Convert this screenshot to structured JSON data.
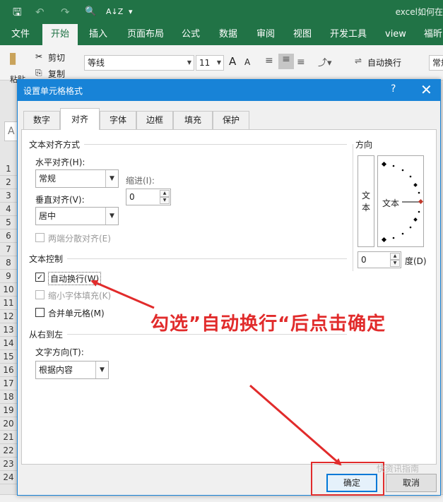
{
  "window": {
    "title": "excel如何在"
  },
  "quick_access": {
    "save": "🖫",
    "undo": "↶",
    "redo": "↷",
    "preview": "🔍",
    "sort": "A↓Z",
    "more": "▾"
  },
  "ribbon_tabs": [
    "文件",
    "开始",
    "插入",
    "页面布局",
    "公式",
    "数据",
    "审阅",
    "视图",
    "开发工具",
    "view",
    "福昕阅"
  ],
  "ribbon": {
    "paste_label": "粘贴",
    "cut_label": "剪切",
    "copy_label": "复制",
    "font_name": "等线",
    "font_size": "11",
    "grow_font": "A",
    "shrink_font": "A",
    "wrap_text": "自动换行",
    "format_value": "常规"
  },
  "sheet": {
    "namebox": "A",
    "rows": [
      "1",
      "2",
      "3",
      "4",
      "5",
      "6",
      "7",
      "8",
      "9",
      "10",
      "11",
      "12",
      "13",
      "14",
      "15",
      "16",
      "17",
      "18",
      "19",
      "20",
      "21",
      "22",
      "23",
      "24"
    ]
  },
  "dialog": {
    "title": "设置单元格格式",
    "help": "?",
    "close": "✕",
    "tabs": [
      "数字",
      "对齐",
      "字体",
      "边框",
      "填充",
      "保护"
    ],
    "text_alignment": {
      "group": "文本对齐方式",
      "horizontal_label": "水平对齐(H):",
      "horizontal_value": "常规",
      "indent_label": "缩进(I):",
      "indent_value": "0",
      "vertical_label": "垂直对齐(V):",
      "vertical_value": "居中",
      "justify_distributed": "两端分散对齐(E)"
    },
    "text_control": {
      "group": "文本控制",
      "wrap_text": "自动换行(W)",
      "wrap_checked": true,
      "shrink_to_fit": "缩小字体填充(K)",
      "merge_cells": "合并单元格(M)"
    },
    "rtl": {
      "group": "从右到左",
      "direction_label": "文字方向(T):",
      "direction_value": "根据内容"
    },
    "orientation": {
      "group": "方向",
      "vertical_text": "文\n本",
      "dial_text": "文本",
      "degrees_value": "0",
      "degrees_label": "度(D)"
    },
    "ok": "确定",
    "cancel": "取消"
  },
  "annotation": "勾选”自动换行“后点击确定",
  "watermark": "快资讯指南",
  "colors": {
    "excel_green": "#217346",
    "dialog_blue": "#1883d7",
    "annotation_red": "#e12b2b"
  }
}
